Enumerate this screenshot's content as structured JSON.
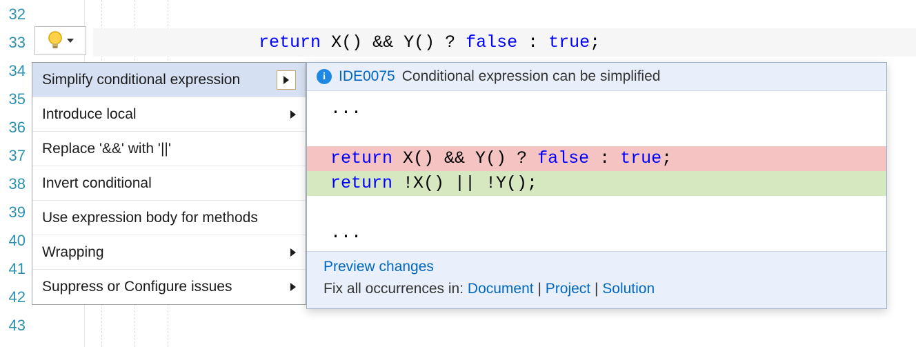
{
  "gutter": {
    "lines": [
      "32",
      "33",
      "34",
      "35",
      "36",
      "37",
      "38",
      "39",
      "40",
      "41",
      "42",
      "43"
    ]
  },
  "code": {
    "line33": {
      "indent": "                ",
      "kw": "return",
      "mid": " X() && Y() ? ",
      "false": "false",
      "between": " : ",
      "true": "true",
      "end": ";"
    }
  },
  "menu": {
    "items": [
      {
        "label": "Simplify conditional expression",
        "submenu": true,
        "selected": true
      },
      {
        "label": "Introduce local",
        "submenu": true
      },
      {
        "label": "Replace '&&' with '||'",
        "submenu": false
      },
      {
        "label": "Invert conditional",
        "submenu": false
      },
      {
        "label": "Use expression body for methods",
        "submenu": false
      },
      {
        "label": "Wrapping",
        "submenu": true
      },
      {
        "label": "Suppress or Configure issues",
        "submenu": true
      }
    ]
  },
  "preview": {
    "code_id": "IDE0075",
    "message": "Conditional expression can be simplified",
    "ellipsis": "...",
    "diff_del": {
      "kw": "return",
      "mid": " X() && Y() ? ",
      "false": "false",
      "between": " : ",
      "true": "true",
      "end": ";"
    },
    "diff_add": {
      "kw": "return",
      "rest": " !X() || !Y();"
    },
    "preview_link": "Preview changes",
    "fix_label": "Fix all occurrences in: ",
    "links": {
      "doc": "Document",
      "proj": "Project",
      "sol": "Solution"
    },
    "sep": " | "
  }
}
